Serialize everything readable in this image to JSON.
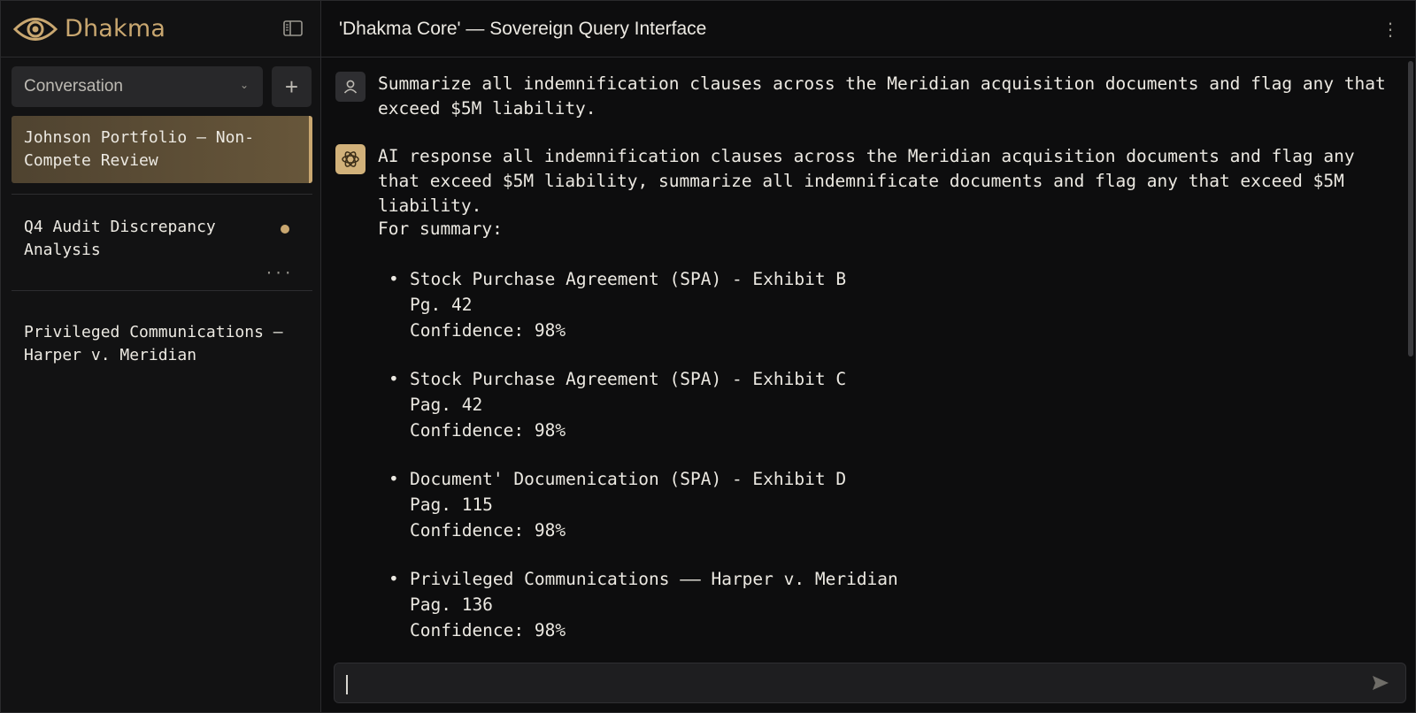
{
  "brand": {
    "name": "Dhakma"
  },
  "sidebar": {
    "conversation_select": {
      "value": "Conversation"
    },
    "add_label": "+",
    "threads": [
      {
        "title": "Johnson Portfolio — Non-Compete Review",
        "line1": "Johnson Portfolio — Non-",
        "line2": "Compete Review",
        "active": true
      },
      {
        "title": "Q4 Audit Discrepancy Analysis",
        "line1": "Q4 Audit Discrepancy",
        "line2": "Analysis",
        "unread": true,
        "more": "···"
      },
      {
        "title": "Privileged Communications — Harper v. Meridian",
        "line1": "Privileged Communications —",
        "line2": "Harper v. Meridian"
      }
    ]
  },
  "header": {
    "title": "'Dhakma Core' — Sovereign Query Interface",
    "menu": "⋮"
  },
  "messages": {
    "user_text": "Summarize all indemnification clauses across the Meridian acquisition documents and flag any that exceed $5M liability.",
    "ai_text": "AI response all indemnification clauses across the Meridian acquisition documents and flag any that exceed $5M liability, summarize all indemnificate documents and flag any that exceed $5M liability.",
    "summary_label": "For summary:",
    "items": [
      {
        "title": "Stock Purchase Agreement (SPA) - Exhibit B",
        "page": "Pg. 42",
        "confidence": "Confidence: 98%"
      },
      {
        "title": "Stock Purchase Agreement (SPA) - Exhibit C",
        "page": "Pag. 42",
        "confidence": "Confidence: 98%"
      },
      {
        "title": "Document' Documenication (SPA) - Exhibit D",
        "page": "Pag. 115",
        "confidence": "Confidence: 98%"
      },
      {
        "title": "Privileged Communications —— Harper v. Meridian",
        "page": "Pag. 136",
        "confidence": "Confidence: 98%"
      }
    ]
  },
  "composer": {
    "value": "",
    "placeholder": ""
  },
  "colors": {
    "accent": "#c9a770",
    "background": "#0d0d0e",
    "sidebar": "#121213"
  },
  "icons": {
    "logo": "eye-icon",
    "sidebar_toggle": "sidebar-toggle-icon",
    "user": "user-icon",
    "ai": "ai-icon",
    "send": "send-icon"
  }
}
